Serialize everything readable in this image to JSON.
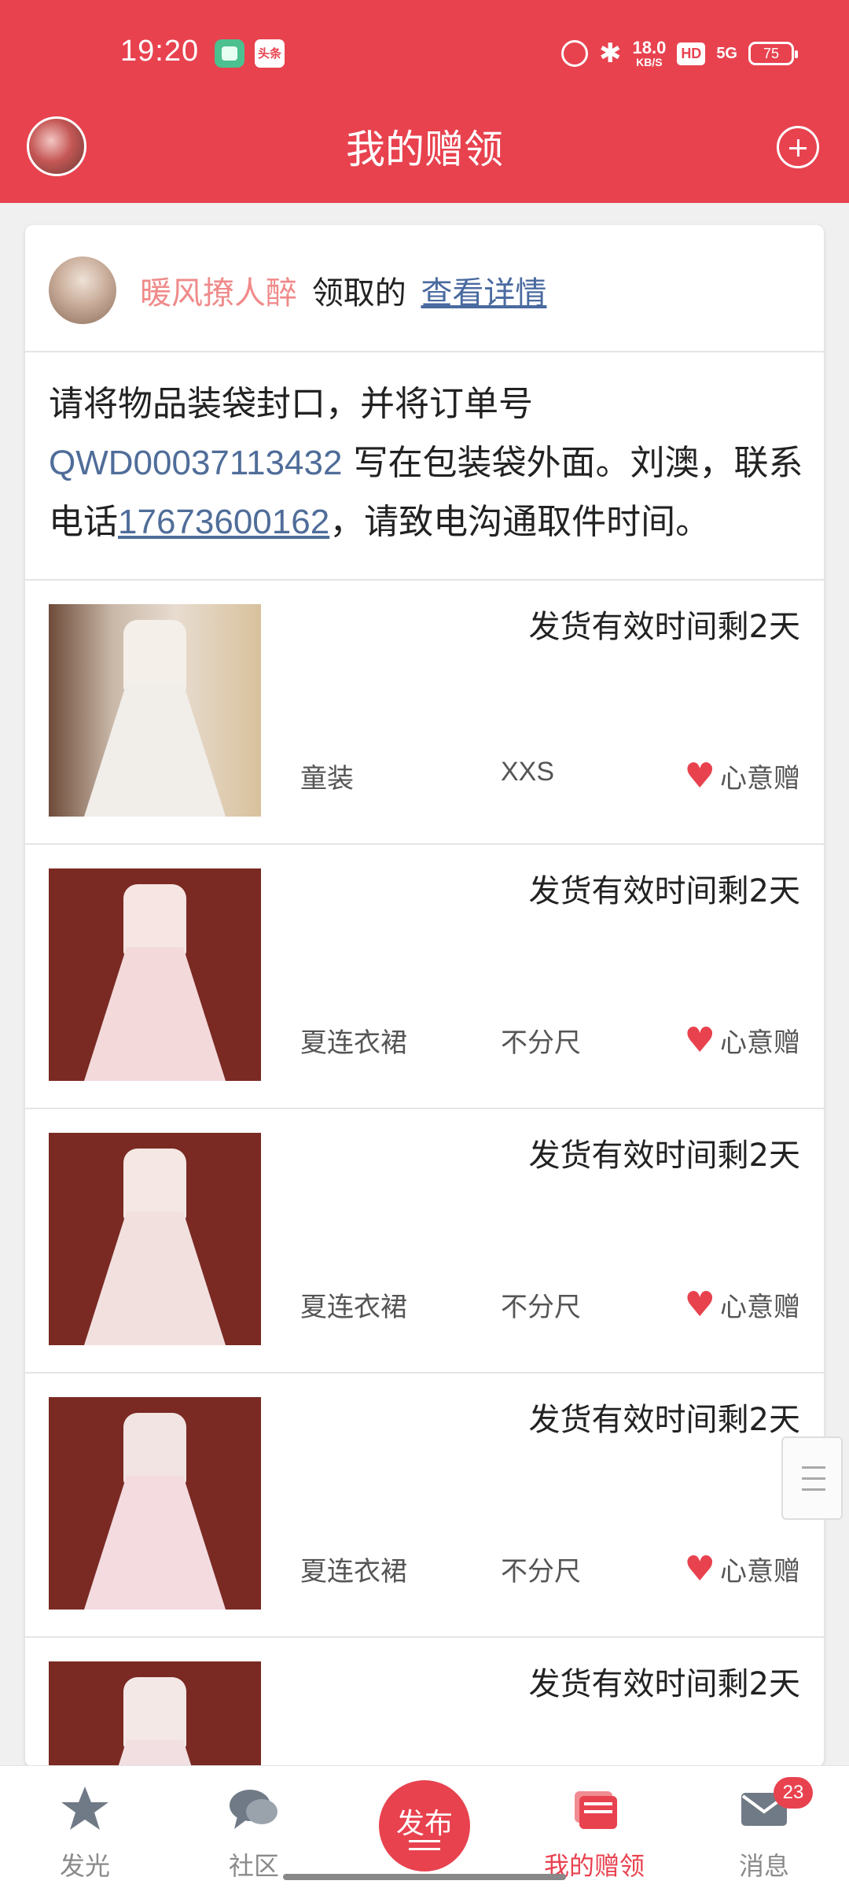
{
  "status_bar": {
    "time": "19:20",
    "app_badge": "头条",
    "speed_value": "18.0",
    "speed_unit": "KB/S",
    "hd": "HD",
    "network": "5G",
    "battery": "75"
  },
  "header": {
    "title": "我的赠领"
  },
  "claim": {
    "user": "暖风撩人醉",
    "action": "领取的",
    "link": "查看详情"
  },
  "instructions": {
    "part1": "请将物品装袋封口，并将订单号 ",
    "order_no": "QWD00037113432",
    "part2": " 写在包装袋外面。刘澳，联系电话",
    "phone": "17673600162",
    "part3": "，请致电沟通取件时间。"
  },
  "items": [
    {
      "timer": "发货有效时间剩2天",
      "category": "童装",
      "size": "XXS",
      "gift_type": "心意赠"
    },
    {
      "timer": "发货有效时间剩2天",
      "category": "夏连衣裙",
      "size": "不分尺",
      "gift_type": "心意赠"
    },
    {
      "timer": "发货有效时间剩2天",
      "category": "夏连衣裙",
      "size": "不分尺",
      "gift_type": "心意赠"
    },
    {
      "timer": "发货有效时间剩2天",
      "category": "夏连衣裙",
      "size": "不分尺",
      "gift_type": "心意赠"
    },
    {
      "timer": "发货有效时间剩2天"
    }
  ],
  "nav": {
    "items": [
      {
        "label": "发光",
        "icon": "star-icon"
      },
      {
        "label": "社区",
        "icon": "chat-bubbles-icon"
      },
      {
        "label": "发布",
        "icon": "publish-icon"
      },
      {
        "label": "我的赠领",
        "icon": "gift-box-icon"
      },
      {
        "label": "消息",
        "icon": "mail-icon"
      }
    ],
    "message_badge": "23"
  },
  "colors": {
    "brand": "#e8424f",
    "link": "#4f6d99",
    "username": "#f08a8a"
  }
}
